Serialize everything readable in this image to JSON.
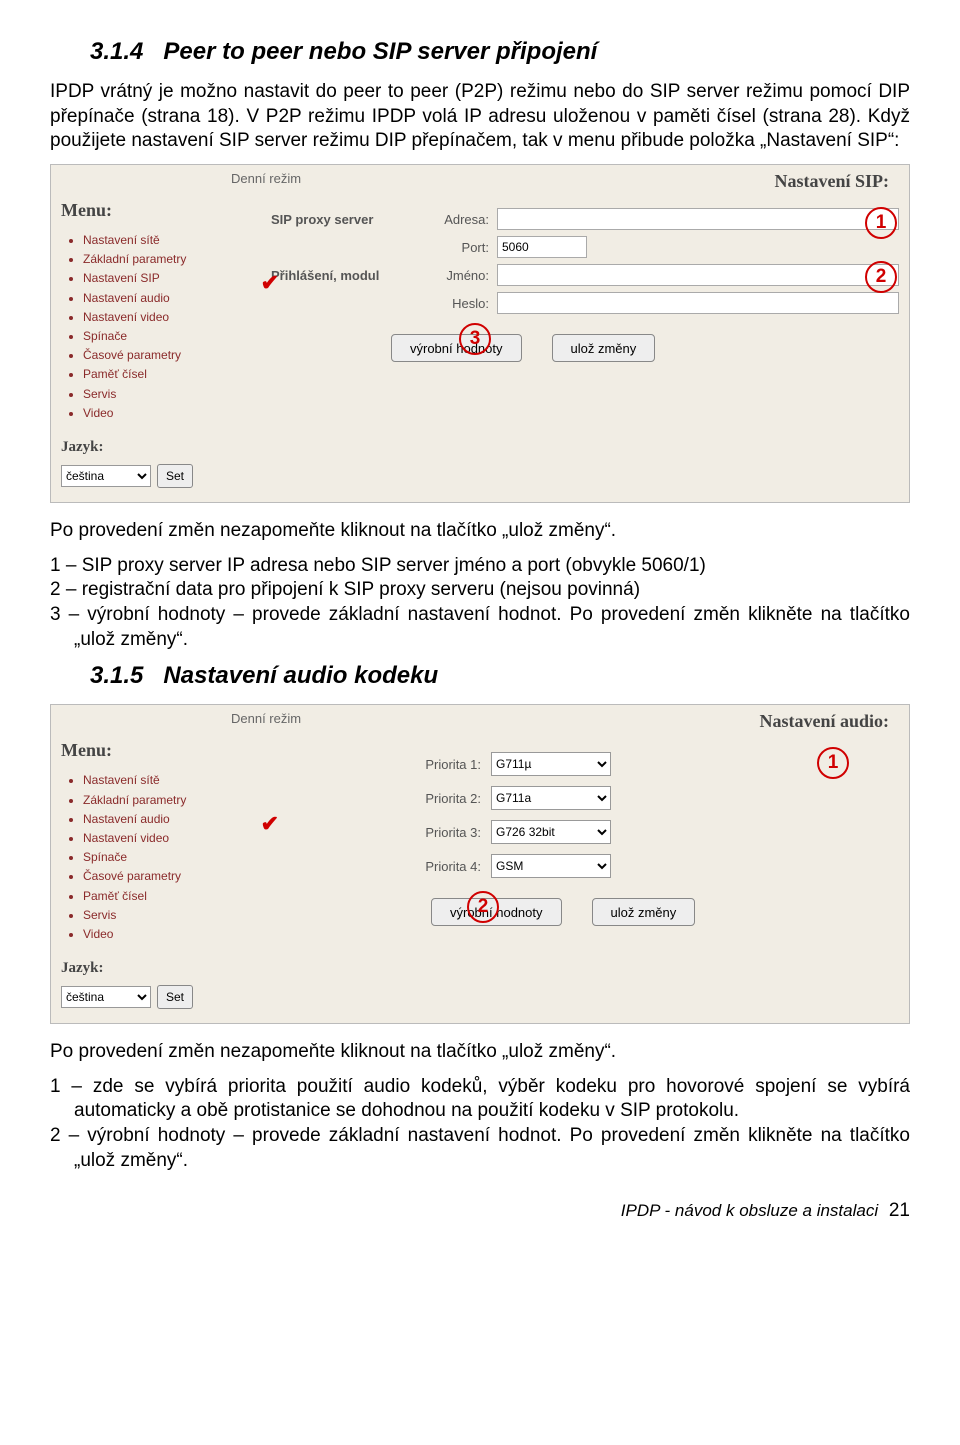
{
  "section1": {
    "num": "3.1.4",
    "title": "Peer to peer nebo SIP server připojení",
    "para1": "IPDP vrátný je možno nastavit do peer to peer (P2P) režimu nebo do SIP server režimu pomocí DIP přepínače (strana 18). V P2P režimu IPDP volá IP adresu uloženou v paměti čísel (strana 28). Když použijete nastavení SIP server režimu DIP přepínačem, tak v menu přibude položka „Nastavení SIP“:"
  },
  "panel1": {
    "mode": "Denní režim",
    "heading": "Nastavení SIP:",
    "menu_title": "Menu:",
    "menu_items": [
      "Nastavení sítě",
      "Základní parametry",
      "Nastavení SIP",
      "Nastavení audio",
      "Nastavení video",
      "Spínače",
      "Časové parametry",
      "Paměť čísel",
      "Servis",
      "Video"
    ],
    "checked_index": 2,
    "lang_label": "Jazyk:",
    "lang_value": "čeština",
    "set_btn": "Set",
    "group1": "SIP proxy server",
    "adresa": "Adresa:",
    "adresa_val": "",
    "port": "Port:",
    "port_val": "5060",
    "group2": "Přihlášení, modul",
    "jmeno": "Jméno:",
    "jmeno_val": "",
    "heslo": "Heslo:",
    "heslo_val": "",
    "btn1": "výrobní hodnoty",
    "btn2": "ulož změny"
  },
  "mid_text": {
    "p1": "Po provedení změn nezapomeňte kliknout na tlačítko „ulož změny“.",
    "p2": "1 – SIP proxy server IP adresa nebo SIP server jméno a port (obvykle 5060/1)",
    "p3": "2 – registrační data pro připojení k SIP proxy serveru (nejsou povinná)",
    "p4": "3 – výrobní hodnoty – provede základní nastavení hodnot. Po provedení změn klikněte na tlačítko „ulož změny“."
  },
  "section2": {
    "num": "3.1.5",
    "title": "Nastavení audio kodeku"
  },
  "panel2": {
    "mode": "Denní režim",
    "heading": "Nastavení audio:",
    "menu_title": "Menu:",
    "menu_items": [
      "Nastavení sítě",
      "Základní parametry",
      "Nastavení audio",
      "Nastavení video",
      "Spínače",
      "Časové parametry",
      "Paměť čísel",
      "Servis",
      "Video"
    ],
    "checked_index": 2,
    "lang_label": "Jazyk:",
    "lang_value": "čeština",
    "set_btn": "Set",
    "row1_label": "Priorita 1:",
    "row1_val": "G711µ",
    "row2_label": "Priorita 2:",
    "row2_val": "G711a",
    "row3_label": "Priorita 3:",
    "row3_val": "G726 32bit",
    "row4_label": "Priorita 4:",
    "row4_val": "GSM",
    "btn1": "výrobní hodnoty",
    "btn2": "ulož změny"
  },
  "end_text": {
    "p1": "Po provedení změn nezapomeňte kliknout na tlačítko „ulož změny“.",
    "p2": "1 – zde se vybírá priorita použití audio kodeků, výběr kodeku pro hovorové spojení se vybírá automaticky a obě protistanice se dohodnou na použití kodeku v SIP protokolu.",
    "p3": "2 – výrobní hodnoty – provede základní nastavení hodnot. Po provedení změn klikněte na tlačítko „ulož změny“."
  },
  "footer": {
    "text": "IPDP - návod k obsluze a instalaci",
    "page": "21"
  }
}
